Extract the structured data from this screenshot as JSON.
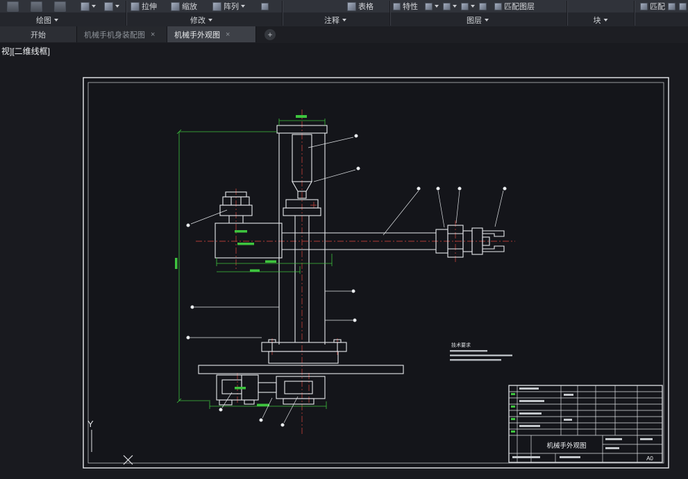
{
  "ribbon": {
    "buttons": {
      "stretch": "拉伸",
      "scale": "缩放",
      "array": "阵列",
      "table": "表格",
      "properties": "特性",
      "match_layer": "匹配图层",
      "match_props": "匹配"
    },
    "panels": {
      "draw": "绘图",
      "modify": "修改",
      "annotate": "注释",
      "layers": "图层",
      "block": "块"
    }
  },
  "tabs": {
    "start": "开始",
    "doc_assembly": "机械手机身装配图",
    "doc_appearance": "机械手外观图",
    "close_glyph": "×",
    "new_tab_glyph": "+"
  },
  "viewport": {
    "controls_label": "视][二维线框]"
  },
  "drawing": {
    "notes_title": "技术要求",
    "title_block": {
      "title": "机械手外观图",
      "sheet_size": "A0"
    },
    "ucs_y_label": "Y"
  }
}
